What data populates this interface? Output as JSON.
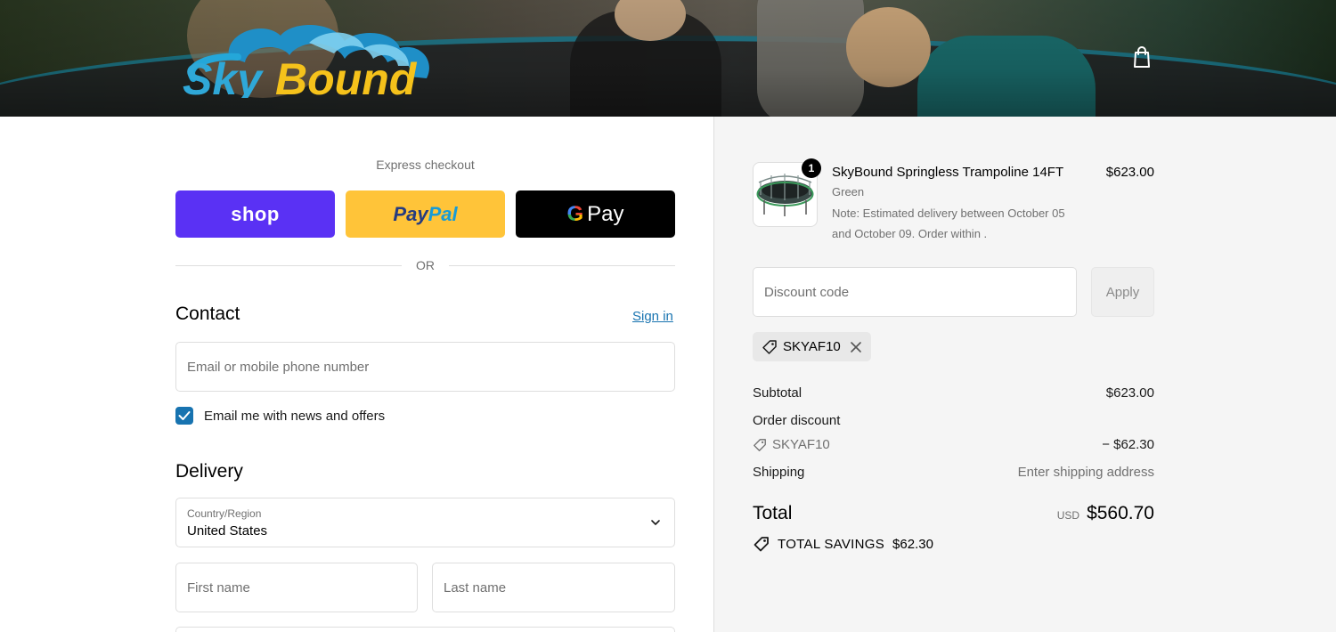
{
  "header": {
    "brand": "SkyBound",
    "bag_icon": "shopping-bag-icon"
  },
  "express_checkout": {
    "title": "Express checkout",
    "shop_label": "shop",
    "paypal_label_1": "Pay",
    "paypal_label_2": "Pal",
    "gpay_g": "G",
    "gpay_label": "Pay",
    "or_label": "OR"
  },
  "contact": {
    "title": "Contact",
    "sign_in_label": "Sign in",
    "email_placeholder": "Email or mobile phone number",
    "email_value": "",
    "newsletter_label": "Email me with news and offers",
    "newsletter_checked": true
  },
  "delivery": {
    "title": "Delivery",
    "country_label": "Country/Region",
    "country_value": "United States",
    "first_name_placeholder": "First name",
    "last_name_placeholder": "Last name"
  },
  "order": {
    "item": {
      "quantity": "1",
      "name": "SkyBound Springless Trampoline 14FT",
      "variant": "Green",
      "note": "Note: Estimated delivery between October 05 and October 09. Order within .",
      "price": "$623.00"
    },
    "discount_placeholder": "Discount code",
    "apply_label": "Apply",
    "applied_code": "SKYAF10",
    "subtotal_label": "Subtotal",
    "subtotal_value": "$623.00",
    "order_discount_label": "Order discount",
    "discount_code": "SKYAF10",
    "discount_value": "− $62.30",
    "shipping_label": "Shipping",
    "shipping_value": "Enter shipping address",
    "total_label": "Total",
    "currency": "USD",
    "total_value": "$560.70",
    "savings_label": "TOTAL SAVINGS",
    "savings_value": "$62.30"
  },
  "colors": {
    "shop_purple": "#5a31f4",
    "paypal_yellow": "#ffc439",
    "link_blue": "#1773b0"
  }
}
